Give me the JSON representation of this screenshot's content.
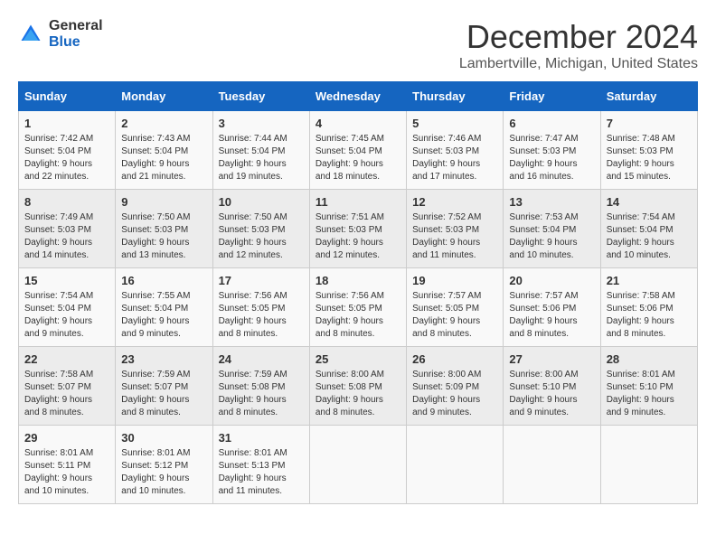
{
  "logo": {
    "line1": "General",
    "line2": "Blue"
  },
  "title": "December 2024",
  "subtitle": "Lambertville, Michigan, United States",
  "weekdays": [
    "Sunday",
    "Monday",
    "Tuesday",
    "Wednesday",
    "Thursday",
    "Friday",
    "Saturday"
  ],
  "weeks": [
    [
      {
        "day": "1",
        "sunrise": "7:42 AM",
        "sunset": "5:04 PM",
        "daylight": "9 hours and 22 minutes."
      },
      {
        "day": "2",
        "sunrise": "7:43 AM",
        "sunset": "5:04 PM",
        "daylight": "9 hours and 21 minutes."
      },
      {
        "day": "3",
        "sunrise": "7:44 AM",
        "sunset": "5:04 PM",
        "daylight": "9 hours and 19 minutes."
      },
      {
        "day": "4",
        "sunrise": "7:45 AM",
        "sunset": "5:04 PM",
        "daylight": "9 hours and 18 minutes."
      },
      {
        "day": "5",
        "sunrise": "7:46 AM",
        "sunset": "5:03 PM",
        "daylight": "9 hours and 17 minutes."
      },
      {
        "day": "6",
        "sunrise": "7:47 AM",
        "sunset": "5:03 PM",
        "daylight": "9 hours and 16 minutes."
      },
      {
        "day": "7",
        "sunrise": "7:48 AM",
        "sunset": "5:03 PM",
        "daylight": "9 hours and 15 minutes."
      }
    ],
    [
      {
        "day": "8",
        "sunrise": "7:49 AM",
        "sunset": "5:03 PM",
        "daylight": "9 hours and 14 minutes."
      },
      {
        "day": "9",
        "sunrise": "7:50 AM",
        "sunset": "5:03 PM",
        "daylight": "9 hours and 13 minutes."
      },
      {
        "day": "10",
        "sunrise": "7:50 AM",
        "sunset": "5:03 PM",
        "daylight": "9 hours and 12 minutes."
      },
      {
        "day": "11",
        "sunrise": "7:51 AM",
        "sunset": "5:03 PM",
        "daylight": "9 hours and 12 minutes."
      },
      {
        "day": "12",
        "sunrise": "7:52 AM",
        "sunset": "5:03 PM",
        "daylight": "9 hours and 11 minutes."
      },
      {
        "day": "13",
        "sunrise": "7:53 AM",
        "sunset": "5:04 PM",
        "daylight": "9 hours and 10 minutes."
      },
      {
        "day": "14",
        "sunrise": "7:54 AM",
        "sunset": "5:04 PM",
        "daylight": "9 hours and 10 minutes."
      }
    ],
    [
      {
        "day": "15",
        "sunrise": "7:54 AM",
        "sunset": "5:04 PM",
        "daylight": "9 hours and 9 minutes."
      },
      {
        "day": "16",
        "sunrise": "7:55 AM",
        "sunset": "5:04 PM",
        "daylight": "9 hours and 9 minutes."
      },
      {
        "day": "17",
        "sunrise": "7:56 AM",
        "sunset": "5:05 PM",
        "daylight": "9 hours and 8 minutes."
      },
      {
        "day": "18",
        "sunrise": "7:56 AM",
        "sunset": "5:05 PM",
        "daylight": "9 hours and 8 minutes."
      },
      {
        "day": "19",
        "sunrise": "7:57 AM",
        "sunset": "5:05 PM",
        "daylight": "9 hours and 8 minutes."
      },
      {
        "day": "20",
        "sunrise": "7:57 AM",
        "sunset": "5:06 PM",
        "daylight": "9 hours and 8 minutes."
      },
      {
        "day": "21",
        "sunrise": "7:58 AM",
        "sunset": "5:06 PM",
        "daylight": "9 hours and 8 minutes."
      }
    ],
    [
      {
        "day": "22",
        "sunrise": "7:58 AM",
        "sunset": "5:07 PM",
        "daylight": "9 hours and 8 minutes."
      },
      {
        "day": "23",
        "sunrise": "7:59 AM",
        "sunset": "5:07 PM",
        "daylight": "9 hours and 8 minutes."
      },
      {
        "day": "24",
        "sunrise": "7:59 AM",
        "sunset": "5:08 PM",
        "daylight": "9 hours and 8 minutes."
      },
      {
        "day": "25",
        "sunrise": "8:00 AM",
        "sunset": "5:08 PM",
        "daylight": "9 hours and 8 minutes."
      },
      {
        "day": "26",
        "sunrise": "8:00 AM",
        "sunset": "5:09 PM",
        "daylight": "9 hours and 9 minutes."
      },
      {
        "day": "27",
        "sunrise": "8:00 AM",
        "sunset": "5:10 PM",
        "daylight": "9 hours and 9 minutes."
      },
      {
        "day": "28",
        "sunrise": "8:01 AM",
        "sunset": "5:10 PM",
        "daylight": "9 hours and 9 minutes."
      }
    ],
    [
      {
        "day": "29",
        "sunrise": "8:01 AM",
        "sunset": "5:11 PM",
        "daylight": "9 hours and 10 minutes."
      },
      {
        "day": "30",
        "sunrise": "8:01 AM",
        "sunset": "5:12 PM",
        "daylight": "9 hours and 10 minutes."
      },
      {
        "day": "31",
        "sunrise": "8:01 AM",
        "sunset": "5:13 PM",
        "daylight": "9 hours and 11 minutes."
      },
      null,
      null,
      null,
      null
    ]
  ],
  "labels": {
    "sunrise": "Sunrise:",
    "sunset": "Sunset:",
    "daylight": "Daylight:"
  }
}
